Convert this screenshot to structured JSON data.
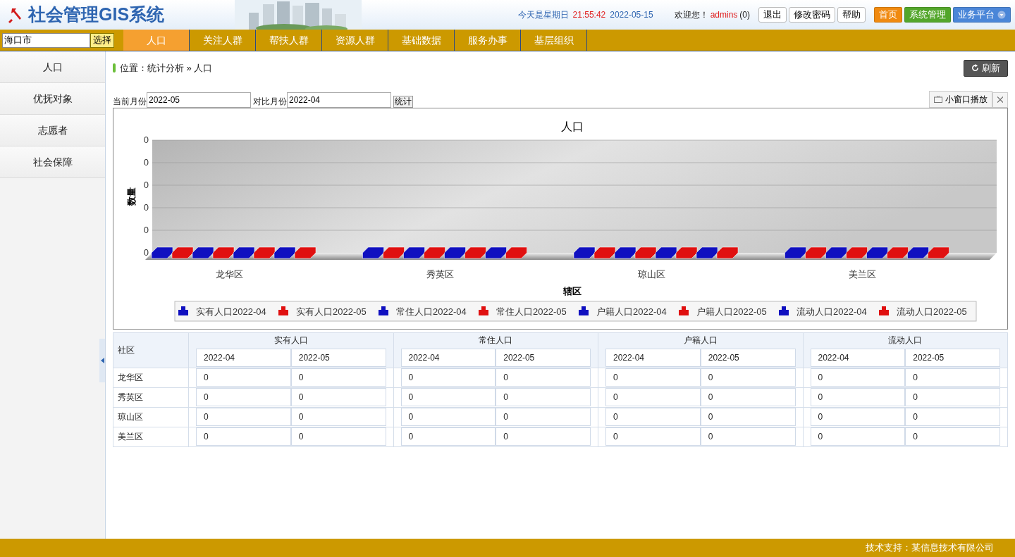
{
  "header": {
    "title": "社会管理GIS系统",
    "weekday": "今天是星期日",
    "time": "21:55:42",
    "date": "2022-05-15",
    "welcome": "欢迎您！",
    "user": "admins",
    "message_count": "(0)",
    "buttons": [
      "退出",
      "修改密码",
      "帮助"
    ],
    "platform_buttons": [
      {
        "label": "首页",
        "color": "#f08a10",
        "dropdown": false
      },
      {
        "label": "系统管理",
        "color": "#52a62a",
        "dropdown": false
      },
      {
        "label": "业务平台",
        "color": "#4a86d8",
        "dropdown": true
      }
    ]
  },
  "city": {
    "value": "海口市",
    "button": "选择"
  },
  "tabs": [
    {
      "label": "人口",
      "selected": true
    },
    {
      "label": "关注人群",
      "selected": false
    },
    {
      "label": "帮扶人群",
      "selected": false
    },
    {
      "label": "资源人群",
      "selected": false
    },
    {
      "label": "基础数据",
      "selected": false
    },
    {
      "label": "服务办事",
      "selected": false
    },
    {
      "label": "基层组织",
      "selected": false
    }
  ],
  "sidebar": {
    "items": [
      "人口",
      "优抚对象",
      "志愿者",
      "社会保障"
    ]
  },
  "breadcrumb": "位置：统计分析 » 人口",
  "refresh_button": "刷新",
  "filters": [
    {
      "label": "当前月份",
      "value": "2022-05"
    },
    {
      "label": "对比月份",
      "value": "2022-04"
    }
  ],
  "submit_button": "统计",
  "popup_button": "小窗口播放",
  "chart": {
    "title": "人口",
    "y_tick_labels": [
      "0",
      "0",
      "0",
      "0",
      "0",
      "0"
    ],
    "ylabel": "数量",
    "categories": [
      "龙华区",
      "秀英区",
      "琼山区",
      "美兰区"
    ],
    "xlabel": "辖区",
    "legend": [
      {
        "label": "实有人口2022-04",
        "color": "#1010c0"
      },
      {
        "label": "实有人口2022-05",
        "color": "#e01010"
      },
      {
        "label": "常住人口2022-04",
        "color": "#1010c0"
      },
      {
        "label": "常住人口2022-05",
        "color": "#e01010"
      },
      {
        "label": "户籍人口2022-04",
        "color": "#1010c0"
      },
      {
        "label": "户籍人口2022-05",
        "color": "#e01010"
      },
      {
        "label": "流动人口2022-04",
        "color": "#1010c0"
      },
      {
        "label": "流动人口2022-05",
        "color": "#e01010"
      }
    ]
  },
  "table": {
    "first_column": "社区",
    "groups": [
      {
        "name": "实有人口",
        "columns": [
          "2022-04",
          "2022-05"
        ]
      },
      {
        "name": "常住人口",
        "columns": [
          "2022-04",
          "2022-05"
        ]
      },
      {
        "name": "户籍人口",
        "columns": [
          "2022-04",
          "2022-05"
        ]
      },
      {
        "name": "流动人口",
        "columns": [
          "2022-04",
          "2022-05"
        ]
      }
    ],
    "rows": [
      {
        "name": "龙华区",
        "cells": [
          "0",
          "0",
          "0",
          "0",
          "0",
          "0",
          "0",
          "0"
        ]
      },
      {
        "name": "秀英区",
        "cells": [
          "0",
          "0",
          "0",
          "0",
          "0",
          "0",
          "0",
          "0"
        ]
      },
      {
        "name": "琼山区",
        "cells": [
          "0",
          "0",
          "0",
          "0",
          "0",
          "0",
          "0",
          "0"
        ]
      },
      {
        "name": "美兰区",
        "cells": [
          "0",
          "0",
          "0",
          "0",
          "0",
          "0",
          "0",
          "0"
        ]
      }
    ]
  },
  "footer": "技术支持：某信息技术有限公司"
}
